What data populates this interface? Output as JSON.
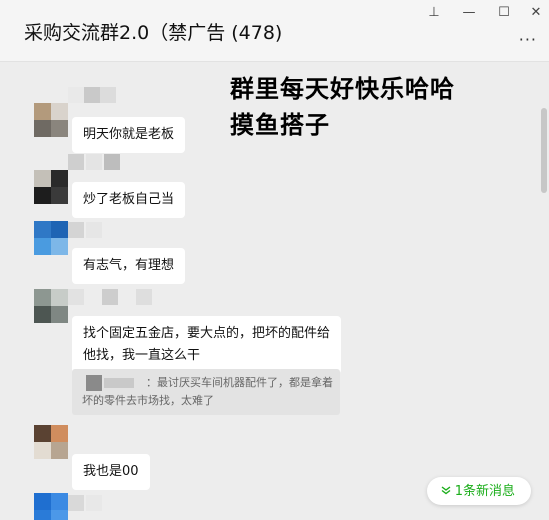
{
  "window": {
    "title": "采购交流群2.0（禁广告 (478)",
    "pin_icon": "pin-icon",
    "minimize_icon": "minimize-icon",
    "maximize_icon": "maximize-icon",
    "close_icon": "close-icon",
    "more_icon": "more-icon",
    "pin_glyph": "⊥",
    "minimize_glyph": "—",
    "maximize_glyph": "☐",
    "close_glyph": "✕",
    "more_glyph": "···"
  },
  "overlay": {
    "line1": "群里每天好快乐哈哈",
    "line2": "摸鱼搭子"
  },
  "messages": [
    {
      "text": "明天你就是老板"
    },
    {
      "text": "炒了老板自己当"
    },
    {
      "text": "有志气，有理想"
    },
    {
      "text": "找个固定五金店，要大点的，把坏的配件给",
      "text2": "他找，我一直这么干"
    },
    {
      "text": "我也是00"
    }
  ],
  "quote": {
    "text": "：最讨厌买车间机器配件了，都是拿着坏的零件去市场找，太难了"
  },
  "new_message_button": {
    "label": "1条新消息",
    "icon": "chevron-down-icon"
  },
  "colors": {
    "accent_green": "#1aad19",
    "chat_background": "#ededed",
    "bubble": "#ffffff"
  }
}
